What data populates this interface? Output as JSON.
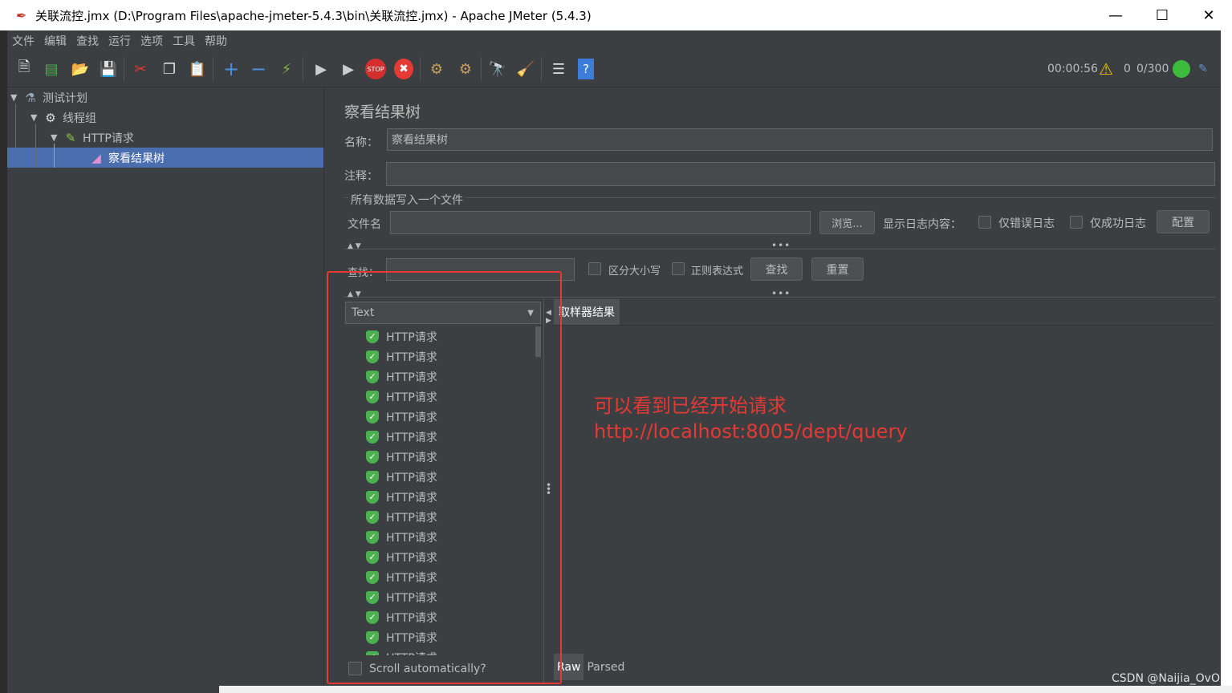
{
  "window": {
    "title": "关联流控.jmx (D:\\Program Files\\apache-jmeter-5.4.3\\bin\\关联流控.jmx) - Apache JMeter (5.4.3)",
    "minimize": "—",
    "maximize": "☐",
    "close": "✕"
  },
  "menu": [
    "文件",
    "编辑",
    "查找",
    "运行",
    "选项",
    "工具",
    "帮助"
  ],
  "toolbar": {
    "icons": [
      "new-icon",
      "templates-icon",
      "open-icon",
      "save-icon",
      "cut-icon",
      "copy-icon",
      "paste-icon",
      "expand-icon",
      "collapse-icon",
      "toggle-icon",
      "start-icon",
      "start-no-pause-icon",
      "stop-icon",
      "shutdown-icon",
      "clear-icon",
      "clear-all-icon",
      "search-icon",
      "reset-search-icon",
      "function-helper-icon",
      "help-icon"
    ],
    "elapsed": "00:00:56",
    "warnings": "0",
    "threads": "0/300"
  },
  "tree": {
    "items": [
      {
        "label": "测试计划",
        "icon": "flask-icon"
      },
      {
        "label": "线程组",
        "icon": "gear-icon"
      },
      {
        "label": "HTTP请求",
        "icon": "pipette-icon"
      },
      {
        "label": "察看结果树",
        "icon": "chart-icon"
      }
    ]
  },
  "panel": {
    "title": "察看结果树",
    "name_label": "名称：",
    "name_value": "察看结果树",
    "comment_label": "注释：",
    "comment_value": "",
    "file_section": "所有数据写入一个文件",
    "filename_label": "文件名",
    "filename_value": "",
    "browse": "浏览...",
    "log_label": "显示日志内容：",
    "errors_only": "仅错误日志",
    "success_only": "仅成功日志",
    "configure": "配置",
    "search_label": "查找：",
    "case_sensitive": "区分大小写",
    "regex": "正则表达式",
    "find": "查找",
    "reset": "重置",
    "renderer": "Text",
    "tab_result": "取样器结果",
    "scroll_auto": "Scroll automatically?",
    "raw": "Raw",
    "parsed": "Parsed"
  },
  "results": {
    "label": "HTTP请求",
    "count_visible": 17
  },
  "annotation": {
    "line1": "可以看到已经开始请求",
    "line2": "http://localhost:8005/dept/query"
  },
  "watermark": "CSDN @Naijia_OvO"
}
